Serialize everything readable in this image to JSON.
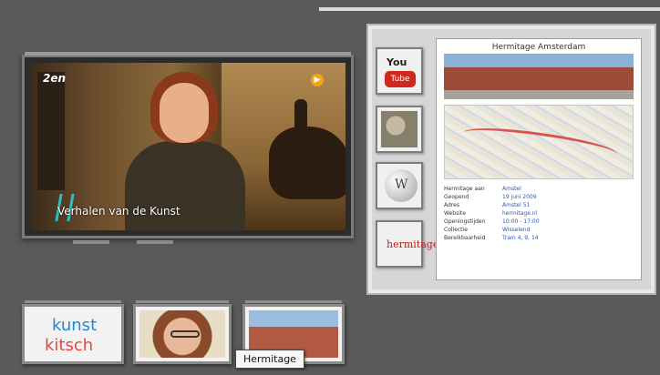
{
  "video": {
    "channel_logo": "2en",
    "caption": "Verhalen van de Kunst",
    "dot_colors": [
      "#2bc0c0",
      "#e64a8c",
      "#f0c22c",
      "#3a8ee6",
      "#58c04a"
    ]
  },
  "side_panel": {
    "icons": [
      {
        "name": "youtube-icon",
        "top_label": "You",
        "bottom_label": "Tube"
      },
      {
        "name": "map-icon"
      },
      {
        "name": "wikipedia-icon"
      },
      {
        "name": "hermitage-logo-icon",
        "label": "hermitage"
      }
    ],
    "info": {
      "title": "Hermitage Amsterdam",
      "rows": [
        {
          "key": "Hermitage aan",
          "value": "Amstel"
        },
        {
          "key": "Geopend",
          "value": "19 juni 2009"
        },
        {
          "key": "Adres",
          "value": "Amstel 51"
        },
        {
          "key": "Website",
          "value": "hermitage.nl"
        },
        {
          "key": "",
          "value": ""
        },
        {
          "key": "Openingstijden",
          "value": "10:00 - 17:00"
        },
        {
          "key": "Collectie",
          "value": "Wisselend"
        },
        {
          "key": "Bereikbaarheid",
          "value": "Tram 4, 9, 14"
        }
      ]
    }
  },
  "thumbnails": [
    {
      "name": "thumb-kunst-kitsch",
      "line1": "kunst",
      "line2": "kitsch"
    },
    {
      "name": "thumb-presenter"
    },
    {
      "name": "thumb-hermitage"
    }
  ],
  "tooltip": "Hermitage"
}
